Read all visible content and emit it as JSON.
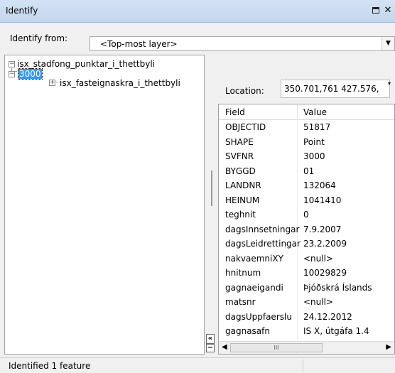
{
  "window": {
    "title": "Identify"
  },
  "identify_from": {
    "label": "Identify from:",
    "selected": "<Top-most layer>"
  },
  "tree": {
    "root_label": "isx_stadfong_punktar_i_thettbyli",
    "child_label": "3000",
    "grandchild_label": "isx_fasteignaskra_i_thettbyli"
  },
  "location": {
    "label": "Location:",
    "value": "350.701,761  427.576,"
  },
  "grid": {
    "field_header": "Field",
    "value_header": "Value",
    "rows": [
      {
        "field": "OBJECTID",
        "value": "51817"
      },
      {
        "field": "SHAPE",
        "value": "Point"
      },
      {
        "field": "SVFNR",
        "value": "3000"
      },
      {
        "field": "BYGGD",
        "value": "01"
      },
      {
        "field": "LANDNR",
        "value": "132064"
      },
      {
        "field": "HEINUM",
        "value": "1041410"
      },
      {
        "field": "teghnit",
        "value": "0"
      },
      {
        "field": "dagsInnsetningar",
        "value": "7.9.2007"
      },
      {
        "field": "dagsLeidrettingar",
        "value": "23.2.2009"
      },
      {
        "field": "nakvaemniXY",
        "value": "<null>"
      },
      {
        "field": "hnitnum",
        "value": "10029829"
      },
      {
        "field": "gagnaeigandi",
        "value": "Þjóðskrá Íslands"
      },
      {
        "field": "matsnr",
        "value": "<null>"
      },
      {
        "field": "dagsUppfaerslu",
        "value": "24.12.2012"
      },
      {
        "field": "gagnasafn",
        "value": "IS X, útgáfa 1.4"
      }
    ]
  },
  "status": {
    "text": "Identified 1 feature"
  }
}
